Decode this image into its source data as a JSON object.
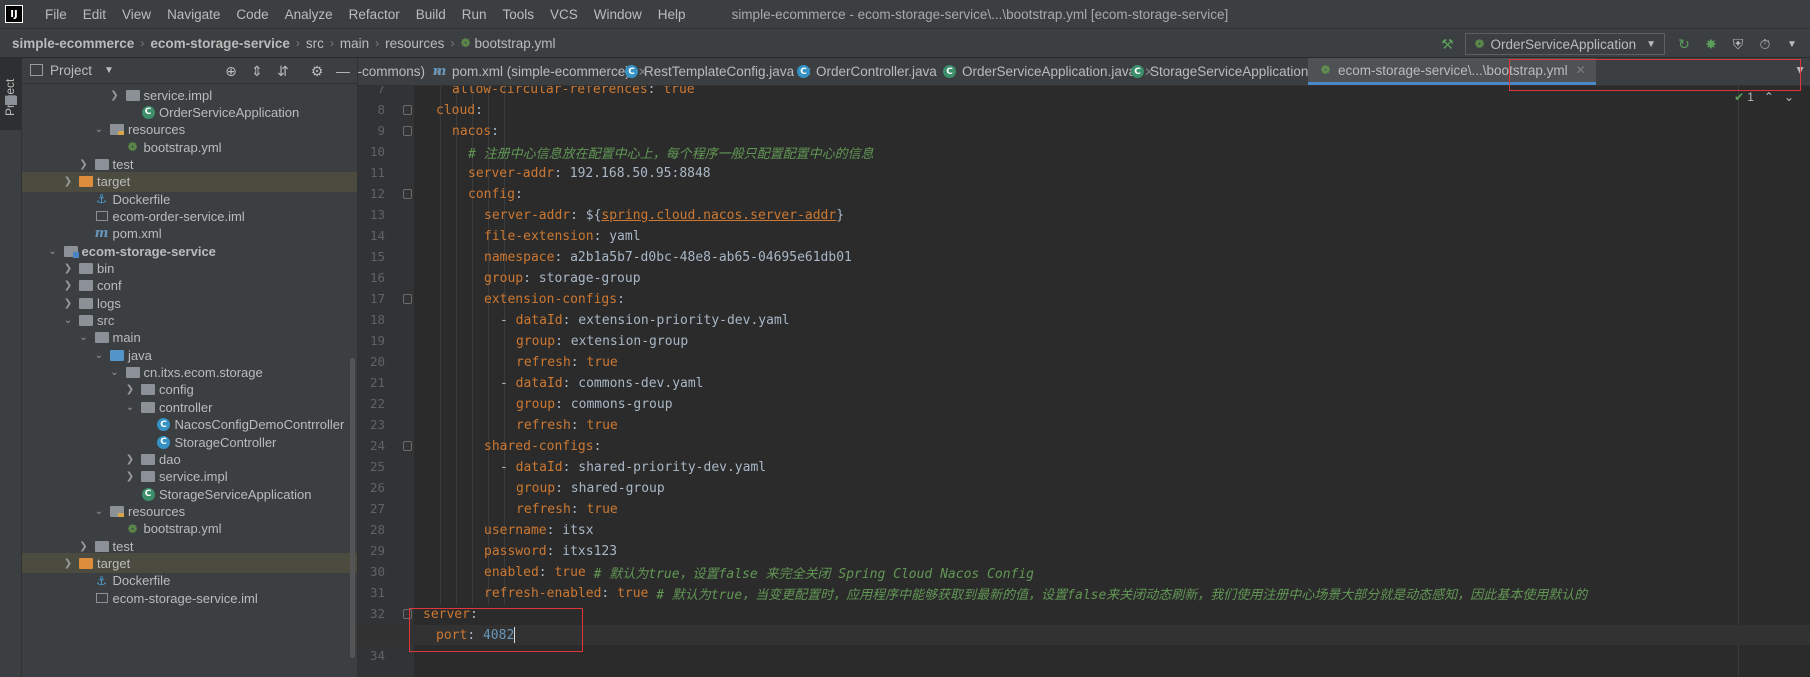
{
  "app": {
    "logo_text": "IJ",
    "menu": [
      "File",
      "Edit",
      "View",
      "Navigate",
      "Code",
      "Analyze",
      "Refactor",
      "Build",
      "Run",
      "Tools",
      "VCS",
      "Window",
      "Help"
    ],
    "window_title": "simple-ecommerce - ecom-storage-service\\...\\bootstrap.yml [ecom-storage-service]"
  },
  "navbar": {
    "crumbs": [
      "simple-ecommerce",
      "ecom-storage-service",
      "src",
      "main",
      "resources",
      "bootstrap.yml"
    ],
    "run_config": "OrderServiceApplication"
  },
  "left_stripe": {
    "label": "Project"
  },
  "project_panel": {
    "title": "Project",
    "tree": [
      {
        "label": "service.impl",
        "icon": "folder-gray",
        "indent": 5,
        "arrow": "right"
      },
      {
        "label": "OrderServiceApplication",
        "icon": "spring-class",
        "indent": 6,
        "arrow": ""
      },
      {
        "label": "resources",
        "icon": "folder-resources",
        "indent": 4,
        "arrow": "down"
      },
      {
        "label": "bootstrap.yml",
        "icon": "spring-yml",
        "indent": 5,
        "arrow": ""
      },
      {
        "label": "test",
        "icon": "folder-gray",
        "indent": 3,
        "arrow": "right"
      },
      {
        "label": "target",
        "icon": "folder-orange",
        "indent": 2,
        "arrow": "right",
        "selected": true
      },
      {
        "label": "Dockerfile",
        "icon": "docker",
        "indent": 3,
        "arrow": ""
      },
      {
        "label": "ecom-order-service.iml",
        "icon": "iml",
        "indent": 3,
        "arrow": ""
      },
      {
        "label": "pom.xml",
        "icon": "maven",
        "indent": 3,
        "arrow": ""
      },
      {
        "label": "ecom-storage-service",
        "icon": "folder-module",
        "indent": 1,
        "arrow": "down",
        "bold": true
      },
      {
        "label": "bin",
        "icon": "folder-gray",
        "indent": 2,
        "arrow": "right"
      },
      {
        "label": "conf",
        "icon": "folder-gray",
        "indent": 2,
        "arrow": "right"
      },
      {
        "label": "logs",
        "icon": "folder-gray",
        "indent": 2,
        "arrow": "right"
      },
      {
        "label": "src",
        "icon": "folder-gray",
        "indent": 2,
        "arrow": "down"
      },
      {
        "label": "main",
        "icon": "folder-gray",
        "indent": 3,
        "arrow": "down"
      },
      {
        "label": "java",
        "icon": "folder-blue",
        "indent": 4,
        "arrow": "down"
      },
      {
        "label": "cn.itxs.ecom.storage",
        "icon": "folder-gray",
        "indent": 5,
        "arrow": "down"
      },
      {
        "label": "config",
        "icon": "folder-gray",
        "indent": 6,
        "arrow": "right"
      },
      {
        "label": "controller",
        "icon": "folder-gray",
        "indent": 6,
        "arrow": "down"
      },
      {
        "label": "NacosConfigDemoContrroller",
        "icon": "class",
        "indent": 7,
        "arrow": ""
      },
      {
        "label": "StorageController",
        "icon": "class",
        "indent": 7,
        "arrow": ""
      },
      {
        "label": "dao",
        "icon": "folder-gray",
        "indent": 6,
        "arrow": "right"
      },
      {
        "label": "service.impl",
        "icon": "folder-gray",
        "indent": 6,
        "arrow": "right"
      },
      {
        "label": "StorageServiceApplication",
        "icon": "spring-class",
        "indent": 6,
        "arrow": ""
      },
      {
        "label": "resources",
        "icon": "folder-resources",
        "indent": 4,
        "arrow": "down"
      },
      {
        "label": "bootstrap.yml",
        "icon": "spring-yml",
        "indent": 5,
        "arrow": ""
      },
      {
        "label": "test",
        "icon": "folder-gray",
        "indent": 3,
        "arrow": "right"
      },
      {
        "label": "target",
        "icon": "folder-orange",
        "indent": 2,
        "arrow": "right",
        "selected": true
      },
      {
        "label": "Dockerfile",
        "icon": "docker",
        "indent": 3,
        "arrow": ""
      },
      {
        "label": "ecom-storage-service.iml",
        "icon": "iml",
        "indent": 3,
        "arrow": ""
      }
    ]
  },
  "tabs": [
    {
      "label": "(ecom-commons)",
      "icon": "",
      "closable": true
    },
    {
      "label": "pom.xml (simple-ecommerce)",
      "icon": "maven",
      "closable": true
    },
    {
      "label": "RestTemplateConfig.java",
      "icon": "class",
      "closable": true
    },
    {
      "label": "OrderController.java",
      "icon": "class",
      "closable": true
    },
    {
      "label": "OrderServiceApplication.java",
      "icon": "spring-class",
      "closable": true
    },
    {
      "label": "StorageServiceApplication.java",
      "icon": "spring-class",
      "closable": true
    },
    {
      "label": "ecom-storage-service\\...\\bootstrap.yml",
      "icon": "spring-yml",
      "closable": true,
      "active": true
    }
  ],
  "editor": {
    "inspection_count": "1",
    "current_line": 33,
    "lines": [
      {
        "n": 7,
        "indent": 1,
        "parts": [
          [
            "key",
            "allow-circular-references"
          ],
          [
            "val",
            ": "
          ],
          [
            "bool",
            "true"
          ]
        ]
      },
      {
        "n": 8,
        "indent": 0,
        "parts": [
          [
            "key",
            "cloud"
          ],
          [
            "val",
            ":"
          ]
        ]
      },
      {
        "n": 9,
        "indent": 1,
        "parts": [
          [
            "key",
            "nacos"
          ],
          [
            "val",
            ":"
          ]
        ]
      },
      {
        "n": 10,
        "indent": 2,
        "parts": [
          [
            "cmt",
            "# 注册中心信息放在配置中心上，每个程序一般只配置配置中心的信息"
          ]
        ]
      },
      {
        "n": 11,
        "indent": 2,
        "parts": [
          [
            "key",
            "server-addr"
          ],
          [
            "val",
            ": 192.168.50.95:8848"
          ]
        ]
      },
      {
        "n": 12,
        "indent": 2,
        "parts": [
          [
            "key",
            "config"
          ],
          [
            "val",
            ":"
          ]
        ]
      },
      {
        "n": 13,
        "indent": 3,
        "parts": [
          [
            "key",
            "server-addr"
          ],
          [
            "val",
            ": ${"
          ],
          [
            "ref",
            "spring.cloud.nacos.server-addr"
          ],
          [
            "val",
            "}"
          ]
        ]
      },
      {
        "n": 14,
        "indent": 3,
        "parts": [
          [
            "key",
            "file-extension"
          ],
          [
            "val",
            ": yaml"
          ]
        ]
      },
      {
        "n": 15,
        "indent": 3,
        "parts": [
          [
            "key",
            "namespace"
          ],
          [
            "val",
            ": a2b1a5b7-d0bc-48e8-ab65-04695e61db01"
          ]
        ]
      },
      {
        "n": 16,
        "indent": 3,
        "parts": [
          [
            "key",
            "group"
          ],
          [
            "val",
            ": storage-group"
          ]
        ]
      },
      {
        "n": 17,
        "indent": 3,
        "parts": [
          [
            "key",
            "extension-configs"
          ],
          [
            "val",
            ":"
          ]
        ]
      },
      {
        "n": 18,
        "indent": 4,
        "parts": [
          [
            "val",
            "- "
          ],
          [
            "key",
            "dataId"
          ],
          [
            "val",
            ": extension-priority-dev.yaml"
          ]
        ]
      },
      {
        "n": 19,
        "indent": 5,
        "parts": [
          [
            "key",
            "group"
          ],
          [
            "val",
            ": extension-group"
          ]
        ]
      },
      {
        "n": 20,
        "indent": 5,
        "parts": [
          [
            "key",
            "refresh"
          ],
          [
            "val",
            ": "
          ],
          [
            "bool",
            "true"
          ]
        ]
      },
      {
        "n": 21,
        "indent": 4,
        "parts": [
          [
            "val",
            "- "
          ],
          [
            "key",
            "dataId"
          ],
          [
            "val",
            ": commons-dev.yaml"
          ]
        ]
      },
      {
        "n": 22,
        "indent": 5,
        "parts": [
          [
            "key",
            "group"
          ],
          [
            "val",
            ": commons-group"
          ]
        ]
      },
      {
        "n": 23,
        "indent": 5,
        "parts": [
          [
            "key",
            "refresh"
          ],
          [
            "val",
            ": "
          ],
          [
            "bool",
            "true"
          ]
        ]
      },
      {
        "n": 24,
        "indent": 3,
        "parts": [
          [
            "key",
            "shared-configs"
          ],
          [
            "val",
            ":"
          ]
        ]
      },
      {
        "n": 25,
        "indent": 4,
        "parts": [
          [
            "val",
            "- "
          ],
          [
            "key",
            "dataId"
          ],
          [
            "val",
            ": shared-priority-dev.yaml"
          ]
        ]
      },
      {
        "n": 26,
        "indent": 5,
        "parts": [
          [
            "key",
            "group"
          ],
          [
            "val",
            ": shared-group"
          ]
        ]
      },
      {
        "n": 27,
        "indent": 5,
        "parts": [
          [
            "key",
            "refresh"
          ],
          [
            "val",
            ": "
          ],
          [
            "bool",
            "true"
          ]
        ]
      },
      {
        "n": 28,
        "indent": 3,
        "parts": [
          [
            "key",
            "username"
          ],
          [
            "val",
            ": itsx"
          ]
        ]
      },
      {
        "n": 29,
        "indent": 3,
        "parts": [
          [
            "key",
            "password"
          ],
          [
            "val",
            ": itxs123"
          ]
        ]
      },
      {
        "n": 30,
        "indent": 3,
        "parts": [
          [
            "key",
            "enabled"
          ],
          [
            "val",
            ": "
          ],
          [
            "bool",
            "true"
          ],
          [
            "cmt",
            " # 默认为true，设置false 来完全关闭 Spring Cloud Nacos Config"
          ]
        ]
      },
      {
        "n": 31,
        "indent": 3,
        "parts": [
          [
            "key",
            "refresh-enabled"
          ],
          [
            "val",
            ": "
          ],
          [
            "bool",
            "true"
          ],
          [
            "cmt",
            " # 默认为true，当变更配置时，应用程序中能够获取到最新的值，设置false来关闭动态刷新，我们使用注册中心场景大部分就是动态感知，因此基本使用默认的"
          ]
        ]
      },
      {
        "n": 32,
        "indent": -1,
        "parts": [
          [
            "key",
            "server"
          ],
          [
            "val",
            ":"
          ]
        ]
      },
      {
        "n": 33,
        "indent": 0,
        "parts": [
          [
            "key",
            "port"
          ],
          [
            "val",
            ": "
          ],
          [
            "num",
            "4082"
          ]
        ]
      },
      {
        "n": 34,
        "indent": 0,
        "parts": []
      }
    ]
  },
  "colors": {
    "background": "#2b2b2b",
    "panel": "#3c3f41",
    "yaml_key": "#cc7832",
    "comment": "#629755",
    "number": "#6897bb",
    "annotation_red": "#e0353a",
    "active_tab_underline": "#4a88c7"
  }
}
